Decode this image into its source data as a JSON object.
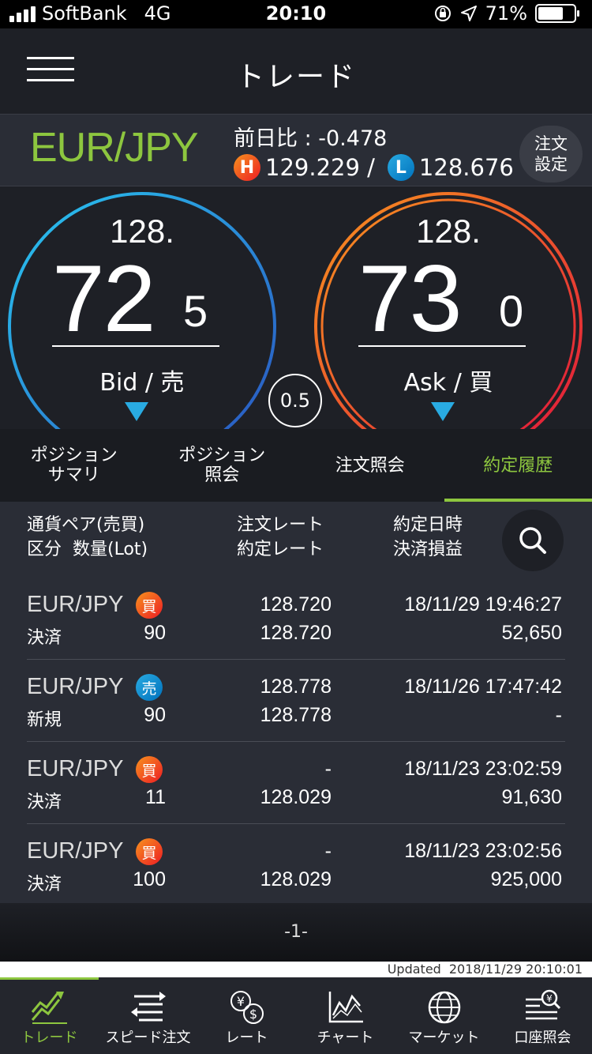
{
  "status": {
    "carrier": "SoftBank",
    "network": "4G",
    "time": "20:10",
    "battery": "71%"
  },
  "header": {
    "title": "トレード"
  },
  "pair_info": {
    "pair": "EUR/JPY",
    "change_label": "前日比 : -0.478",
    "high_badge": "H",
    "high": "129.229 /",
    "low_badge": "L",
    "low": "128.676",
    "order_setting_line1": "注文",
    "order_setting_line2": "設定"
  },
  "quotes": {
    "bid": {
      "prefix": "128.",
      "main": "72",
      "pip": "5",
      "label": "Bid / 売",
      "color": "#29abe2"
    },
    "ask": {
      "prefix": "128.",
      "main": "73",
      "pip": "0",
      "label": "Ask / 買",
      "color": "#f7931e"
    },
    "spread": "0.5"
  },
  "tabs": [
    {
      "line1": "ポジション",
      "line2": "サマリ"
    },
    {
      "line1": "ポジション",
      "line2": "照会"
    },
    {
      "line1": "注文照会",
      "line2": ""
    },
    {
      "line1": "約定履歴",
      "line2": ""
    }
  ],
  "list_header": {
    "col1_line1": "通貨ペア(売買)",
    "col1_line2": "区分  数量(Lot)",
    "col2_line1": "注文レート",
    "col2_line2": "約定レート",
    "col3_line1": "約定日時",
    "col3_line2": "決済損益"
  },
  "rows": [
    {
      "pair": "EUR/JPY",
      "side": "買",
      "kind": "決済",
      "qty": "90",
      "order_rate": "128.720",
      "exec_rate": "128.720",
      "datetime": "18/11/29 19:46:27",
      "pl": "52,650"
    },
    {
      "pair": "EUR/JPY",
      "side": "売",
      "kind": "新規",
      "qty": "90",
      "order_rate": "128.778",
      "exec_rate": "128.778",
      "datetime": "18/11/26 17:47:42",
      "pl": "-"
    },
    {
      "pair": "EUR/JPY",
      "side": "買",
      "kind": "決済",
      "qty": "11",
      "order_rate": "-",
      "exec_rate": "128.029",
      "datetime": "18/11/23 23:02:59",
      "pl": "91,630"
    },
    {
      "pair": "EUR/JPY",
      "side": "買",
      "kind": "決済",
      "qty": "100",
      "order_rate": "-",
      "exec_rate": "128.029",
      "datetime": "18/11/23 23:02:56",
      "pl": "925,000"
    }
  ],
  "pager": {
    "page": "-1-"
  },
  "updated": {
    "label": "Updated",
    "datetime": "2018/11/29 20:10:01"
  },
  "tabbar": [
    {
      "label": "トレード",
      "icon": "trade-chart-icon"
    },
    {
      "label": "スピード注文",
      "icon": "speed-order-icon"
    },
    {
      "label": "レート",
      "icon": "rate-currency-icon"
    },
    {
      "label": "チャート",
      "icon": "chart-icon"
    },
    {
      "label": "マーケット",
      "icon": "globe-icon"
    },
    {
      "label": "口座照会",
      "icon": "account-search-icon"
    }
  ],
  "colors": {
    "accent": "#8dc63f",
    "buy": "#f7931e",
    "sell": "#29abe2"
  }
}
